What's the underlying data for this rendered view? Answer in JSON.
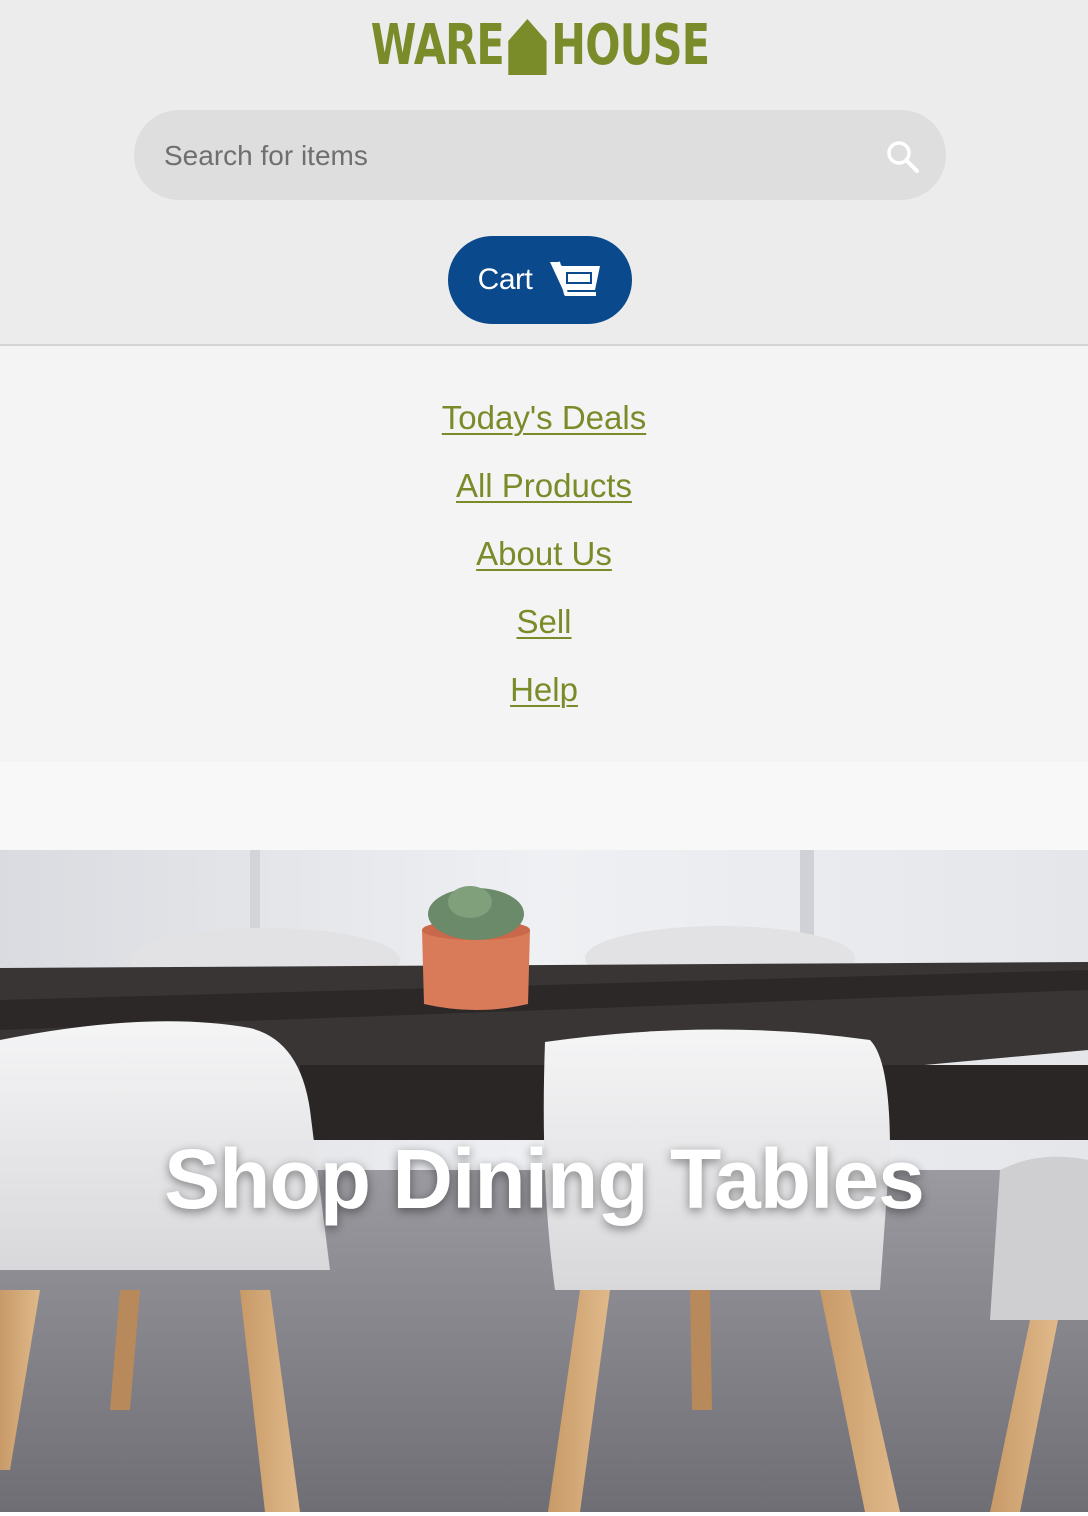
{
  "brand": {
    "logo_left": "WARE",
    "logo_right": "HOUSE",
    "color": "#7a8c2a"
  },
  "search": {
    "placeholder": "Search for items",
    "value": "",
    "icon": "search-icon"
  },
  "cart": {
    "label": "Cart",
    "icon": "shopping-cart-icon",
    "color": "#0a4a8c"
  },
  "nav": {
    "items": [
      {
        "label": "Today's Deals"
      },
      {
        "label": "All Products"
      },
      {
        "label": "About Us"
      },
      {
        "label": "Sell"
      },
      {
        "label": "Help"
      }
    ]
  },
  "hero": {
    "title": "Shop Dining Tables"
  }
}
